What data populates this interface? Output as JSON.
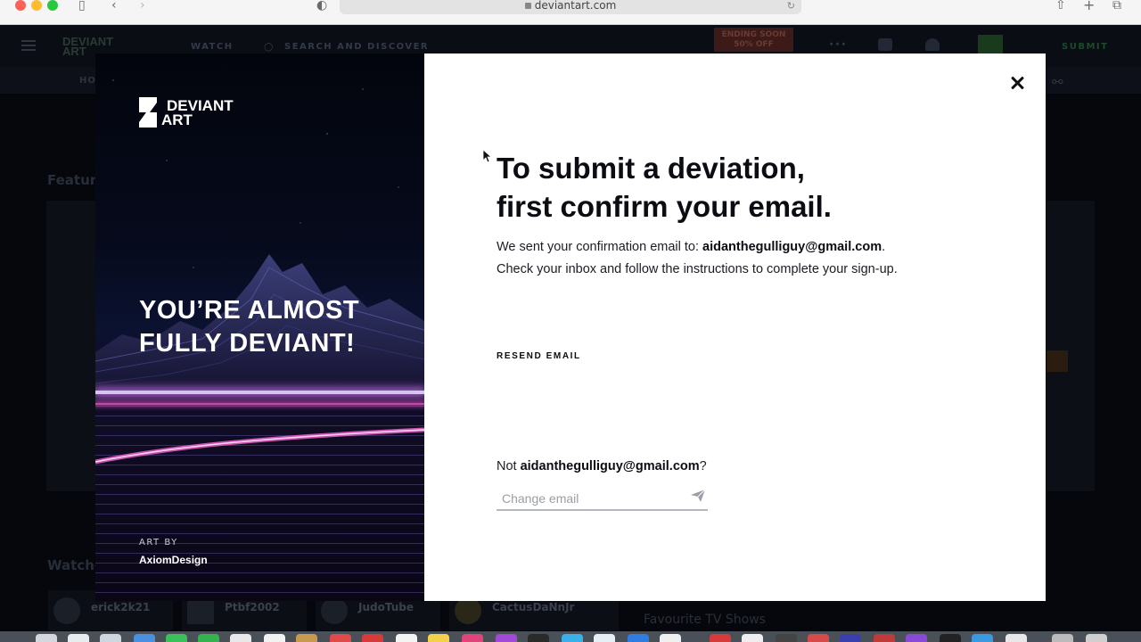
{
  "browser": {
    "url": "deviantart.com"
  },
  "background_page": {
    "nav_watch": "WATCH",
    "search_placeholder": "SEARCH AND DISCOVER",
    "ending_soon_line1": "ENDING SOON",
    "ending_soon_line2": "50% OFF",
    "submit": "SUBMIT",
    "subnav_partial": "HO",
    "featured_partial": "Featur",
    "watch_partial": "Watche",
    "watch_users": [
      "erick2k21",
      "Ptbf2002",
      "JudoTube",
      "CactusDaNnJr"
    ],
    "favourite_text": "Favourite TV Shows"
  },
  "modal": {
    "logo_line1": "DEVIANT",
    "logo_line2": "ART",
    "headline_line1": "YOU’RE ALMOST",
    "headline_line2": "FULLY DEVIANT!",
    "art_by_label": "ART BY",
    "art_by_name": "AxiomDesign",
    "title_line1": "To submit a deviation,",
    "title_line2": "first confirm your email.",
    "sent_prefix": "We sent your confirmation email to: ",
    "email": "aidanthegulliguy@gmail.com",
    "sent_suffix": ". Check your inbox and follow the instructions to complete your sign-up.",
    "resend_label": "RESEND EMAIL",
    "not_prefix": "Not ",
    "not_suffix": "?",
    "change_email_placeholder": "Change email"
  },
  "colors": {
    "modal_bg": "#ffffff",
    "overlay": "#05070c",
    "title_text": "#0b0d12",
    "brand_green": "#05cc47",
    "art_glow_pink": "#c04aa8"
  },
  "icons": {
    "close": "close-icon",
    "send": "send-icon",
    "logo": "deviantart-logo-icon"
  }
}
